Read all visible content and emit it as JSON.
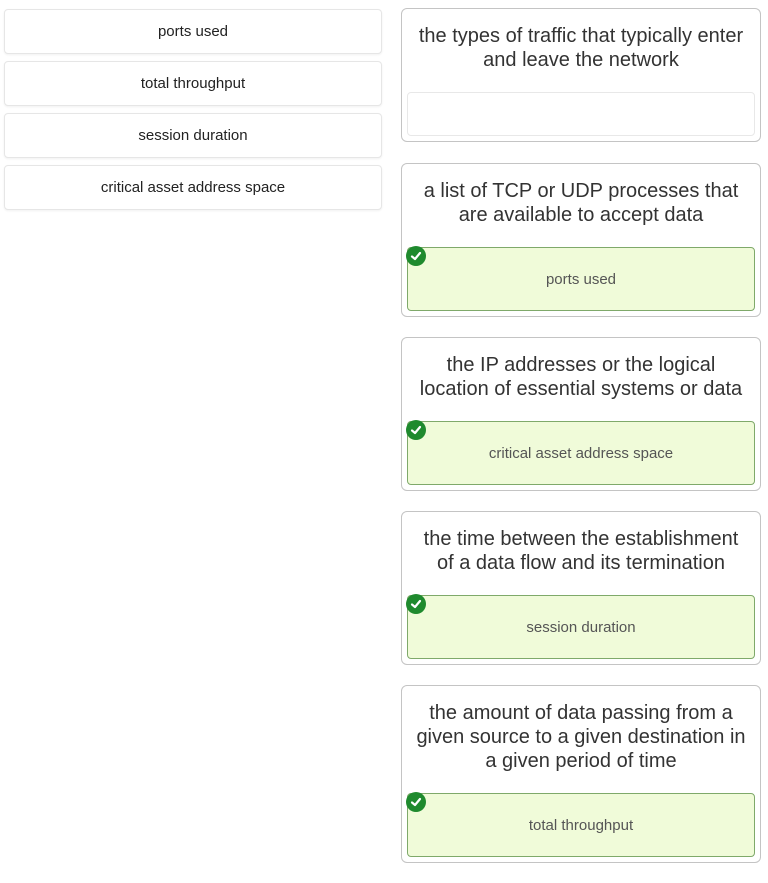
{
  "source_items": [
    {
      "label": "ports used"
    },
    {
      "label": "total throughput"
    },
    {
      "label": "session duration"
    },
    {
      "label": "critical asset address space"
    }
  ],
  "targets": [
    {
      "prompt": "the types of traffic that typically enter and leave the network",
      "answer": null,
      "status": "empty"
    },
    {
      "prompt": "a list of TCP or UDP processes that are available to accept data",
      "answer": "ports used",
      "status": "correct"
    },
    {
      "prompt": "the IP addresses or the logical location of essential systems or data",
      "answer": "critical asset address space",
      "status": "correct"
    },
    {
      "prompt": "the time between the establishment of a data flow and its termination",
      "answer": "session duration",
      "status": "correct"
    },
    {
      "prompt": "the amount of data passing from a given source to a given destination in a given period of time",
      "answer": "total throughput",
      "status": "correct"
    }
  ],
  "colors": {
    "correct_fill": "#f0fbd9",
    "correct_border": "#7fa96a",
    "check_icon": "#1f8a2e"
  },
  "icons": {
    "correct": "check-circle-icon"
  }
}
